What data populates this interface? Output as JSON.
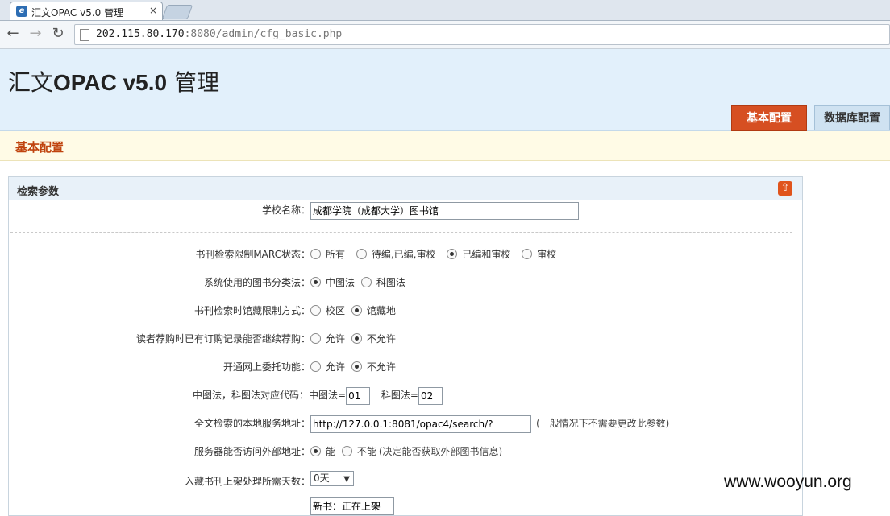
{
  "browser": {
    "tab_title": "汇文OPAC v5.0 管理",
    "tab_close": "×",
    "favicon": "e",
    "url_host": "202.115.80.170",
    "url_rest": ":8080/admin/cfg_basic.php",
    "back": "←",
    "forward": "→",
    "reload": "↻"
  },
  "header": {
    "title_prefix": "汇文",
    "title_brand": "OPAC v5.0",
    "title_suffix": " 管理",
    "tabs": [
      {
        "label": "基本配置",
        "active": true
      },
      {
        "label": "数据库配置",
        "active": false
      }
    ]
  },
  "section": {
    "title": "基本配置"
  },
  "panel": {
    "title": "检索参数",
    "collapse_icon": "⇧",
    "school_name": {
      "label": "学校名称：",
      "value": "成都学院（成都大学）图书馆"
    },
    "marc_status": {
      "label": "书刊检索限制MARC状态：",
      "options": [
        "所有",
        "待编,已编,审校",
        "已编和审校",
        "审校"
      ],
      "selected": 2
    },
    "classification": {
      "label": "系统使用的图书分类法：",
      "options": [
        "中图法",
        "科图法"
      ],
      "selected": 0
    },
    "location_limit": {
      "label": "书刊检索时馆藏限制方式：",
      "options": [
        "校区",
        "馆藏地"
      ],
      "selected": 1
    },
    "recommend_ordered": {
      "label": "读者荐购时已有订购记录能否继续荐购：",
      "options": [
        "允许",
        "不允许"
      ],
      "selected": 1
    },
    "online_delegate": {
      "label": "开通网上委托功能：",
      "options": [
        "允许",
        "不允许"
      ],
      "selected": 1
    },
    "class_codes": {
      "label": "中图法，科图法对应代码：",
      "clc_label": "中图法=",
      "clc_value": "01",
      "sci_label": "科图法=",
      "sci_value": "02"
    },
    "fulltext_url": {
      "label": "全文检索的本地服务地址：",
      "value": "http://127.0.0.1:8081/opac4/search/?",
      "hint": "(一般情况下不需要更改此参数)"
    },
    "external_access": {
      "label": "服务器能否访问外部地址：",
      "options": [
        "能",
        "不能"
      ],
      "selected": 0,
      "hint": "(决定能否获取外部图书信息)"
    },
    "shelving_days": {
      "label": "入藏书刊上架处理所需天数：",
      "value": "0天"
    },
    "new_book_text": {
      "value": "新书：正在上架"
    }
  },
  "watermark": "www.wooyun.org"
}
